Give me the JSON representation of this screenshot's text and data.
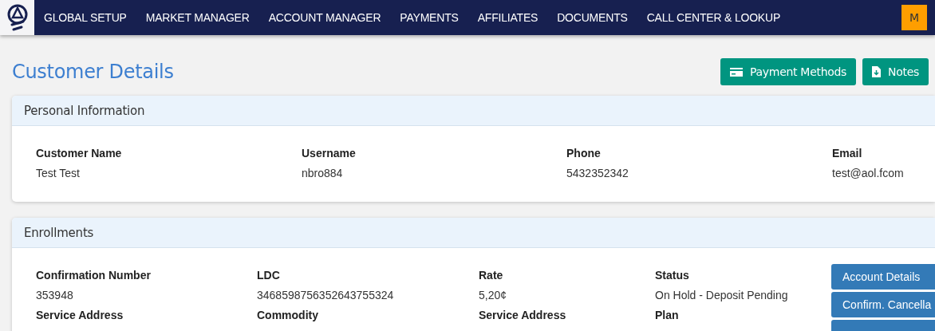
{
  "nav": {
    "items": [
      "GLOBAL SETUP",
      "MARKET MANAGER",
      "ACCOUNT MANAGER",
      "PAYMENTS",
      "AFFILIATES",
      "DOCUMENTS",
      "CALL CENTER & LOOKUP"
    ],
    "avatar": "M"
  },
  "page": {
    "title": "Customer Details",
    "buttons": [
      {
        "kind": "card",
        "label": "Payment Methods"
      },
      {
        "kind": "file",
        "label": "Notes"
      }
    ]
  },
  "personal": {
    "title": "Personal Information",
    "fields": [
      {
        "label": "Customer Name",
        "value": "Test Test"
      },
      {
        "label": "Username",
        "value": "nbro884"
      },
      {
        "label": "Phone",
        "value": "5432352342"
      },
      {
        "label": "Email",
        "value": "test@aol.fcom"
      }
    ]
  },
  "enrollments": {
    "title": "Enrollments",
    "fields": [
      {
        "label": "Confirmation Number",
        "value": "353948"
      },
      {
        "label": "LDC",
        "value": "3468598756352643755324"
      },
      {
        "label": "Rate",
        "value": "5,20¢"
      },
      {
        "label": "Status",
        "value": "On Hold - Deposit Pending"
      },
      {
        "label": "Service Address"
      },
      {
        "label": "Commodity"
      },
      {
        "label": "Service Address"
      },
      {
        "label": "Plan"
      }
    ],
    "actions": [
      "Account Details",
      "Confirm. Cancella"
    ]
  }
}
